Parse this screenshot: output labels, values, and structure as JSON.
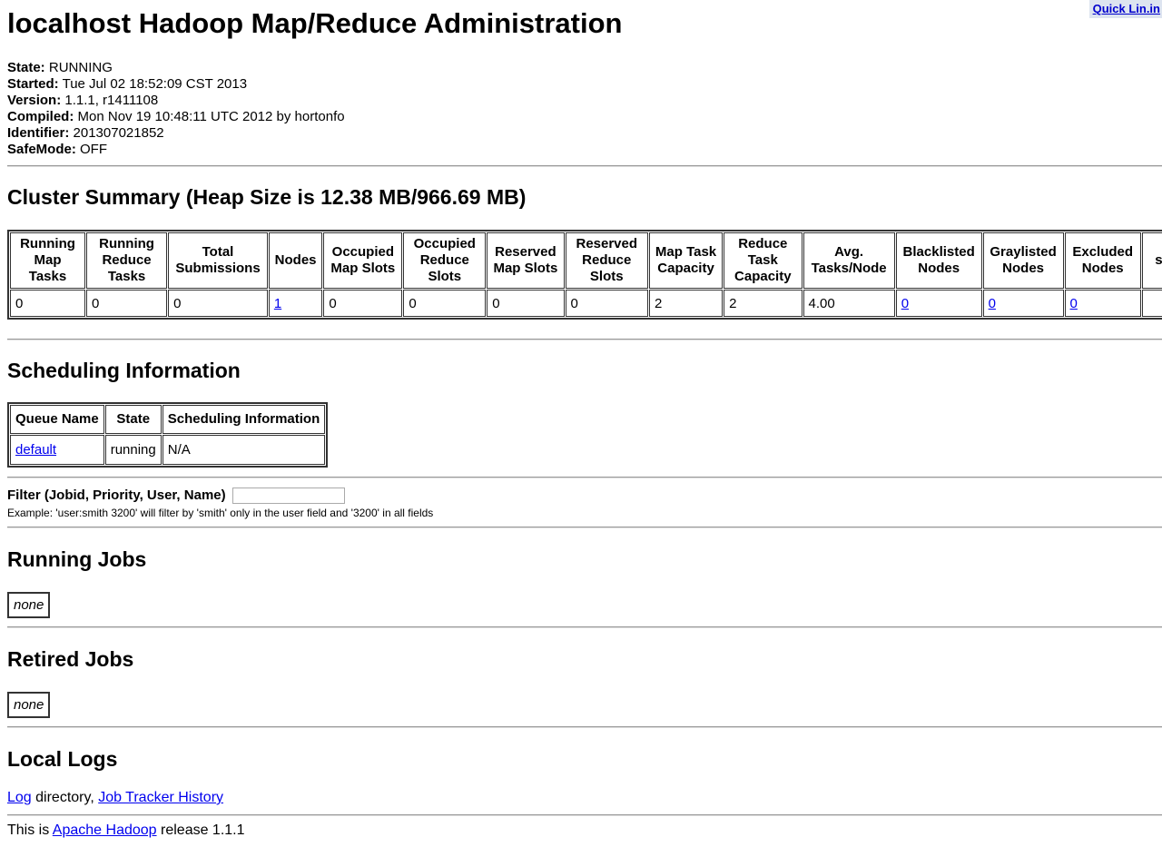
{
  "quick_links": "Quick Lin.in",
  "title": "localhost Hadoop Map/Reduce Administration",
  "info": [
    {
      "label": "State:",
      "value": "RUNNING"
    },
    {
      "label": "Started:",
      "value": "Tue Jul 02 18:52:09 CST 2013"
    },
    {
      "label": "Version:",
      "value": "1.1.1, r1411108"
    },
    {
      "label": "Compiled:",
      "value": "Mon Nov 19 10:48:11 UTC 2012 by hortonfo"
    },
    {
      "label": "Identifier:",
      "value": "201307021852"
    },
    {
      "label": "SafeMode:",
      "value": "OFF"
    }
  ],
  "cluster_summary": {
    "title": "Cluster Summary (Heap Size is 12.38 MB/966.69 MB)",
    "headers": [
      "Running Map Tasks",
      "Running Reduce Tasks",
      "Total Submissions",
      "Nodes",
      "Occupied Map Slots",
      "Occupied Reduce Slots",
      "Reserved Map Slots",
      "Reserved Reduce Slots",
      "Map Task Capacity",
      "Reduce Task Capacity",
      "Avg. Tasks/Node",
      "Blacklisted Nodes",
      "Graylisted Nodes",
      "Excluded Nodes",
      "s"
    ],
    "values": [
      "0",
      "0",
      "0",
      "1",
      "0",
      "0",
      "0",
      "0",
      "2",
      "2",
      "4.00",
      "0",
      "0",
      "0",
      ""
    ]
  },
  "scheduling": {
    "title": "Scheduling Information",
    "headers": [
      "Queue Name",
      "State",
      "Scheduling Information"
    ],
    "row": [
      "default",
      "running",
      "N/A"
    ]
  },
  "filter": {
    "label": "Filter (Jobid, Priority, User, Name)",
    "value": "",
    "example": "Example: 'user:smith 3200' will filter by 'smith' only in the user field and '3200' in all fields"
  },
  "running_jobs": {
    "title": "Running Jobs",
    "empty": "none"
  },
  "retired_jobs": {
    "title": "Retired Jobs",
    "empty": "none"
  },
  "local_logs": {
    "title": "Local Logs",
    "log_link": "Log",
    "mid_text": " directory, ",
    "history_link": "Job Tracker History"
  },
  "footer": {
    "prefix": "This is ",
    "link": "Apache Hadoop",
    "suffix": " release 1.1.1"
  }
}
